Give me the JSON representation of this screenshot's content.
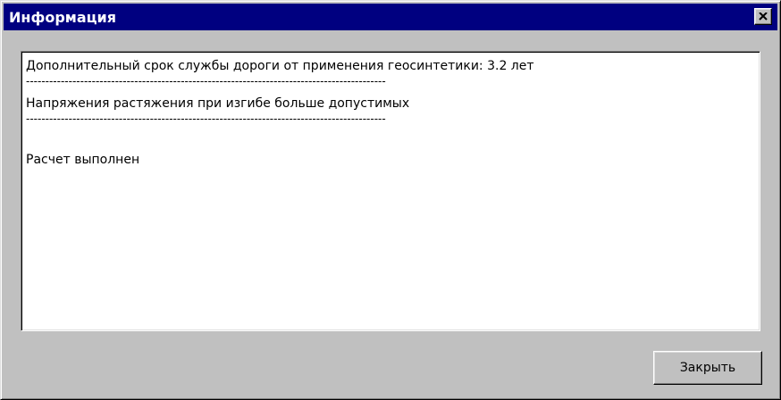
{
  "window": {
    "title": "Информация"
  },
  "titlebar": {
    "close_icon": "close-icon"
  },
  "message": {
    "lines": [
      "Дополнительный срок службы дороги от применения геосинтетики: 3.2 лет",
      "---------------------------------------------------------------------------------------------",
      "Напряжения растяжения при изгибе больше допустимых",
      "---------------------------------------------------------------------------------------------",
      "",
      "Расчет выполнен"
    ]
  },
  "buttons": {
    "close_label": "Закрыть"
  },
  "colors": {
    "titlebar": "#000080",
    "face": "#c0c0c0",
    "text_bg": "#ffffff"
  }
}
